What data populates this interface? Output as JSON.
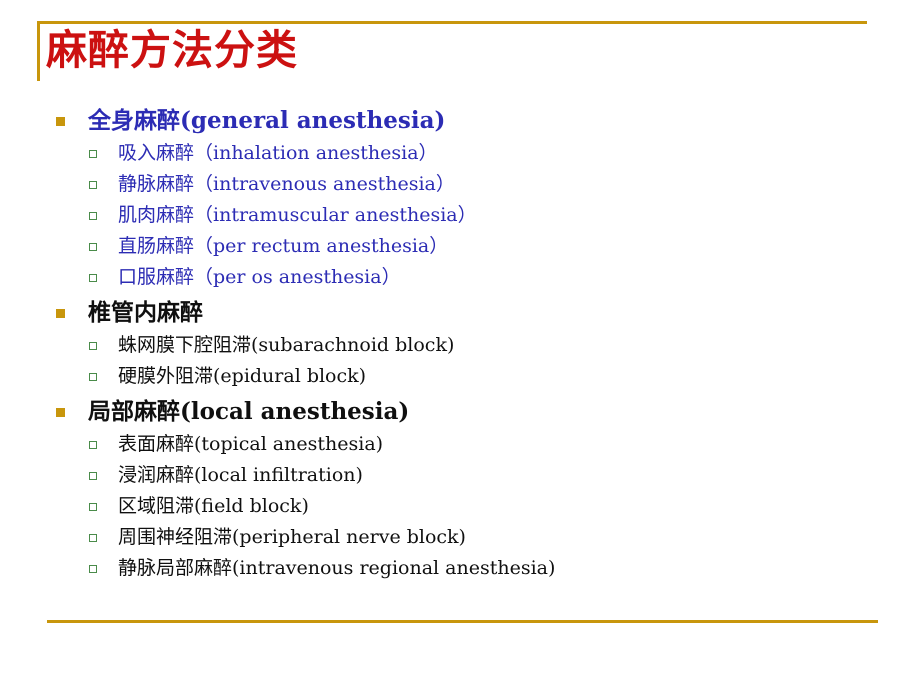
{
  "slide": {
    "title": "麻醉方法分类",
    "title_color": "#cc1111",
    "accent_color": "#c8960c",
    "level1_bullet_color": "#c8960c",
    "level2_bullet_color": "#4a8b4a",
    "blue_text_color": "#2c2cb4",
    "black_text_color": "#101010",
    "background_color": "#ffffff"
  },
  "sections": [
    {
      "heading": "全身麻醉(general anesthesia)",
      "heading_color": "blue",
      "items": [
        {
          "text": "吸入麻醉（inhalation anesthesia）",
          "color": "blue"
        },
        {
          "text": "静脉麻醉（intravenous anesthesia）",
          "color": "blue"
        },
        {
          "text": "肌肉麻醉（intramuscular anesthesia）",
          "color": "blue"
        },
        {
          "text": "直肠麻醉（per rectum anesthesia）",
          "color": "blue"
        },
        {
          "text": "口服麻醉（per os anesthesia）",
          "color": "blue"
        }
      ]
    },
    {
      "heading": "椎管内麻醉",
      "heading_color": "black",
      "items": [
        {
          "text": "蛛网膜下腔阻滞(subarachnoid block)",
          "color": "black"
        },
        {
          "text": "硬膜外阻滞(epidural block)",
          "color": "black"
        }
      ]
    },
    {
      "heading": "局部麻醉(local anesthesia)",
      "heading_color": "black",
      "items": [
        {
          "text": "表面麻醉(topical anesthesia)",
          "color": "black"
        },
        {
          "text": "浸润麻醉(local infiltration)",
          "color": "black"
        },
        {
          "text": "区域阻滞(field block)",
          "color": "black"
        },
        {
          "text": "周围神经阻滞(peripheral nerve block)",
          "color": "black"
        },
        {
          "text": "静脉局部麻醉(intravenous regional anesthesia)",
          "color": "black"
        }
      ]
    }
  ]
}
